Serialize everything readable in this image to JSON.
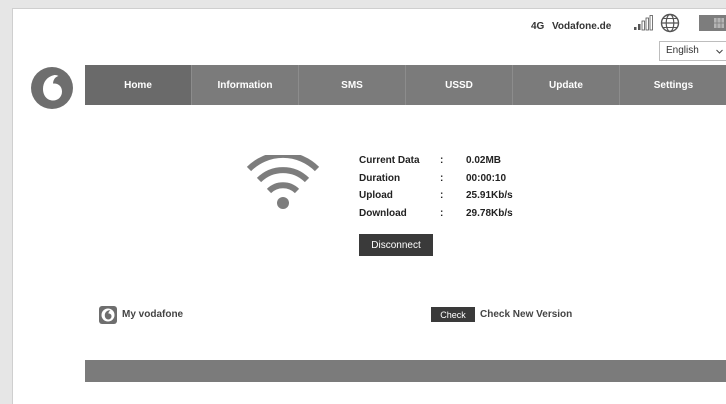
{
  "status": {
    "network_type": "4G",
    "operator": "Vodafone.de",
    "icons": [
      "signal-bars-icon",
      "globe-icon",
      "sim-card-icon"
    ]
  },
  "language": {
    "selected": "English",
    "options": [
      "English"
    ]
  },
  "nav": {
    "items": [
      {
        "label": "Home"
      },
      {
        "label": "Information"
      },
      {
        "label": "SMS"
      },
      {
        "label": "USSD"
      },
      {
        "label": "Update"
      },
      {
        "label": "Settings"
      }
    ],
    "active": "Home"
  },
  "connection": {
    "rows": [
      {
        "label": "Current Data",
        "sep": ":",
        "value": "0.02MB"
      },
      {
        "label": "Duration",
        "sep": ":",
        "value": "00:00:10"
      },
      {
        "label": "Upload",
        "sep": ":",
        "value": "25.91Kb/s"
      },
      {
        "label": "Download",
        "sep": ":",
        "value": "29.78Kb/s"
      }
    ],
    "disconnect_label": "Disconnect"
  },
  "footer": {
    "my_vodafone_label": "My vodafone",
    "check_button_label": "Check",
    "check_text": "Check New Version"
  },
  "colors": {
    "nav_bg": "#7b7b7b",
    "button_bg": "#3a3a3a",
    "icon_gray": "#7d7d7d"
  }
}
